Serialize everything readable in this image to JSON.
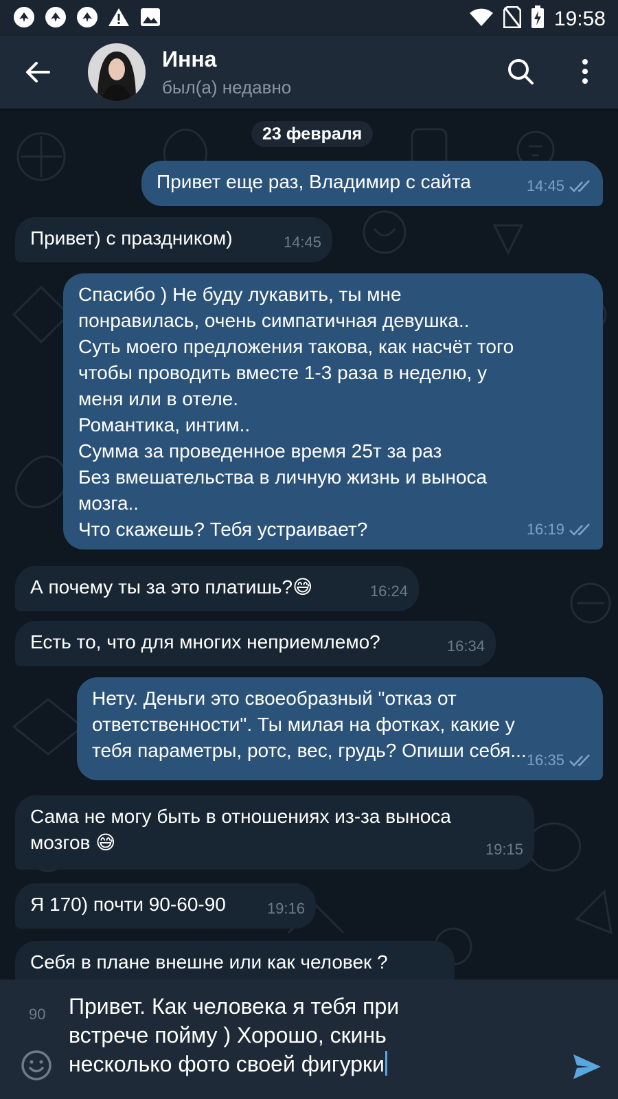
{
  "status_bar": {
    "time": "19:58"
  },
  "header": {
    "title": "Инна",
    "subtitle": "был(а) недавно"
  },
  "chat": {
    "date": "23 февраля",
    "messages": [
      {
        "dir": "out",
        "text": "Привет еще раз, Владимир с сайта",
        "time": "14:45",
        "read": true
      },
      {
        "dir": "in",
        "text": "Привет) с праздником)",
        "time": "14:45"
      },
      {
        "dir": "out",
        "text": "Спасибо ) Не буду лукавить, ты мне\nпонравилась, очень симпатичная девушка..\nСуть моего предложения такова, как насчёт того\nчтобы проводить вместе 1-3 раза в неделю, у\nменя или в отеле.\nРомантика, интим..\nСумма за проведенное время 25т за раз\nБез вмешательства в личную жизнь и выноса\nмозга..\nЧто скажешь? Тебя устраивает?",
        "time": "16:19",
        "read": true
      },
      {
        "dir": "in",
        "text": "А почему ты за это платишь?😅",
        "time": "16:24"
      },
      {
        "dir": "in",
        "text": "Есть то, что для многих неприемлемо?",
        "time": "16:34"
      },
      {
        "dir": "out",
        "text": "Нету. Деньги это своеобразный \"отказ от\nответственности\". Ты милая на фотках, какие у\nтебя параметры, ротс, вес, грудь? Опиши себя...",
        "time": "16:35",
        "read": true
      },
      {
        "dir": "in",
        "text": "Сама не могу быть в отношениях из-за выноса\nмозгов 😅",
        "time": "19:15"
      },
      {
        "dir": "in",
        "text": "Я 170) почти 90-60-90",
        "time": "19:16"
      },
      {
        "dir": "in",
        "text": "Себя в плане внешне или как человек ?",
        "time": ""
      }
    ]
  },
  "composer": {
    "counter": "90",
    "text": "Привет. Как человека я тебя при\nвстрече пойму ) Хорошо, скинь\nнесколько фото своей фигурки"
  },
  "colors": {
    "outgoing_bubble": "#2b5278",
    "incoming_bubble": "#182533",
    "header_bg": "#1f2a38",
    "chat_bg": "#0f1720",
    "accent": "#5aa7e0"
  }
}
